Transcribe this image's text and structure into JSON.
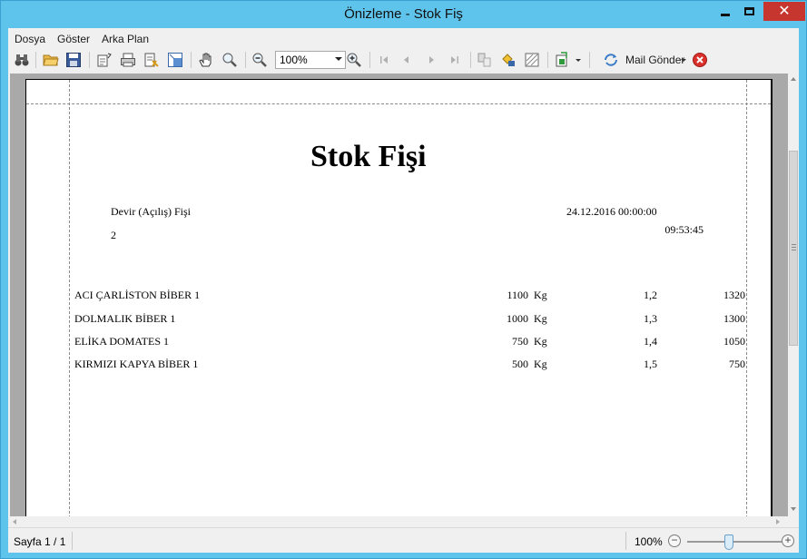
{
  "window": {
    "title": "Önizleme - Stok Fiş"
  },
  "menu": [
    "Dosya",
    "Göster",
    "Arka Plan"
  ],
  "toolbar": {
    "zoom_value": "100%",
    "mail_label": "Mail Gönder",
    "icons": [
      "binoculars-icon",
      "open-folder-icon",
      "save-icon",
      "page-setup-icon",
      "print-icon",
      "print-options-icon",
      "scale-icon",
      "hand-icon",
      "magnifier-icon",
      "zoom-out-icon",
      "zoom-in-icon",
      "first-page-icon",
      "prev-page-icon",
      "next-page-icon",
      "last-page-icon",
      "multipage-icon",
      "color-icon",
      "watermark-icon",
      "export-icon",
      "mail-icon",
      "close-preview-icon"
    ]
  },
  "report": {
    "title": "Stok Fişi",
    "doc_type": "Devir (Açılış) Fişi",
    "doc_no": "2",
    "date": "24.12.2016 00:00:00",
    "time": "09:53:45",
    "rows": [
      {
        "name": "ACI ÇARLİSTON BİBER 1",
        "qty": "1100",
        "unit": "Kg",
        "price": "1,2",
        "total": "1320"
      },
      {
        "name": "DOLMALIK BİBER 1",
        "qty": "1000",
        "unit": "Kg",
        "price": "1,3",
        "total": "1300"
      },
      {
        "name": "ELİKA DOMATES 1",
        "qty": "750",
        "unit": "Kg",
        "price": "1,4",
        "total": "1050"
      },
      {
        "name": "KIRMIZI KAPYA BİBER 1",
        "qty": "500",
        "unit": "Kg",
        "price": "1,5",
        "total": "750"
      }
    ]
  },
  "status": {
    "page": "Sayfa 1 / 1",
    "zoom": "100%"
  },
  "colors": {
    "frame": "#5fc4ec",
    "close": "#c7362e"
  }
}
